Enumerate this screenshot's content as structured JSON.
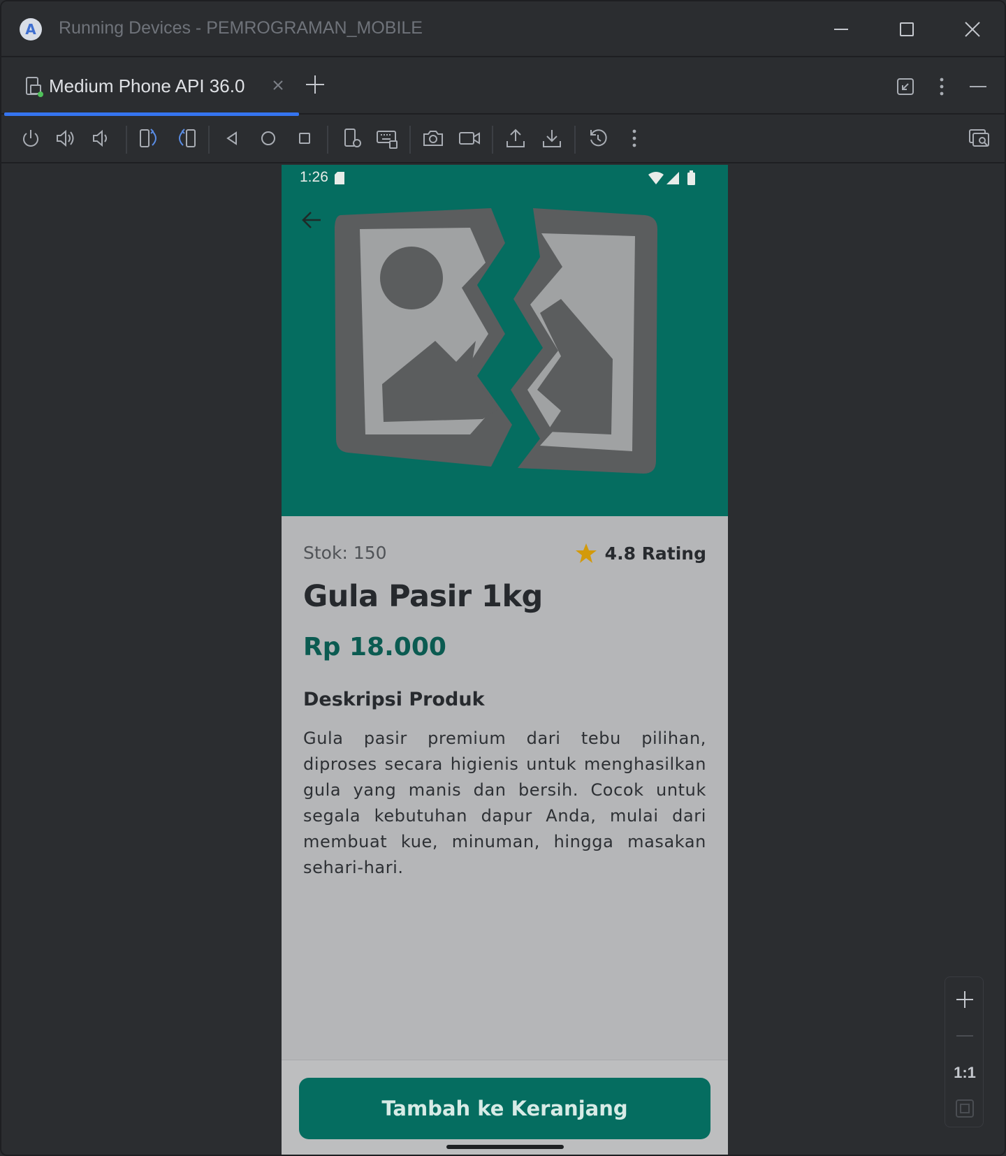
{
  "window": {
    "title": "Running Devices - PEMROGRAMAN_MOBILE",
    "logo_icon": "android-studio-icon"
  },
  "tabs": [
    {
      "label": "Medium Phone API 36.0",
      "active": true
    }
  ],
  "toolbar": {
    "icons": [
      "power-icon",
      "volume-up-icon",
      "volume-down-icon",
      "rotate-left-icon",
      "rotate-right-icon",
      "back-icon",
      "home-icon",
      "overview-icon",
      "device-settings-icon",
      "keyboard-icon",
      "screenshot-icon",
      "screen-record-icon",
      "upload-icon",
      "download-icon",
      "reset-icon",
      "more-icon",
      "inspect-icon"
    ]
  },
  "device": {
    "status_bar": {
      "time": "1:26"
    },
    "product": {
      "stock": "Stok: 150",
      "rating": "4.8 Rating",
      "title": "Gula Pasir 1kg",
      "price": "Rp 18.000",
      "description_heading": "Deskripsi Produk",
      "description": "Gula pasir premium dari tebu pilihan, diproses secara higienis untuk menghasilkan gula yang manis dan bersih. Cocok untuk segala kebutuhan dapur Anda, mulai dari membuat kue, minuman, hingga masakan sehari-hari."
    },
    "cart_button_label": "Tambah ke Keranjang"
  },
  "zoom": {
    "reset_label": "1:1"
  },
  "colors": {
    "accent": "#056d60",
    "price": "#0b5b51",
    "star": "#d39a0b",
    "tab_underline": "#3574f0"
  }
}
